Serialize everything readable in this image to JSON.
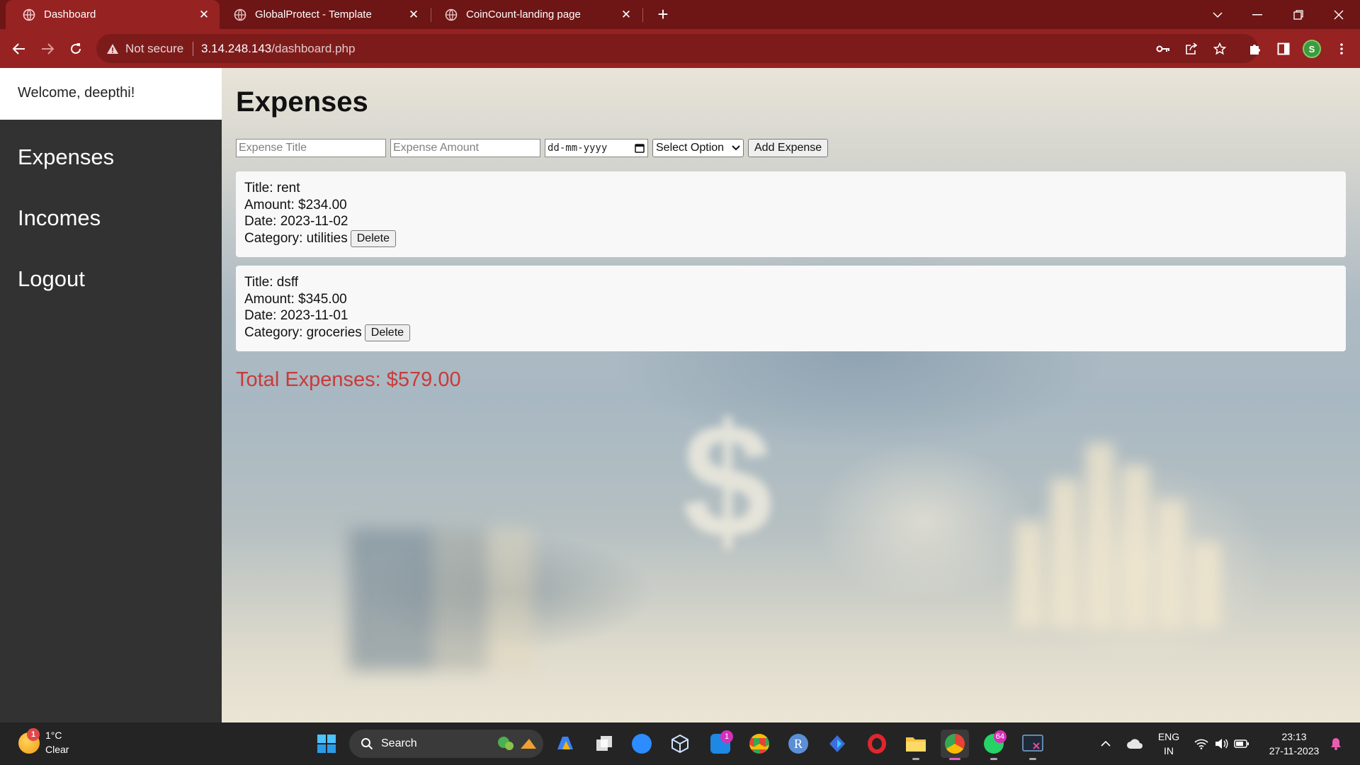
{
  "browser": {
    "tabs": [
      {
        "title": "Dashboard",
        "active": true
      },
      {
        "title": "GlobalProtect - Template",
        "active": false
      },
      {
        "title": "CoinCount-landing page",
        "active": false
      }
    ],
    "tab_close_glyph": "✕",
    "new_tab_glyph": "+",
    "address": {
      "security_label": "Not secure",
      "host": "3.14.248.143",
      "path": "/dashboard.php"
    },
    "profile_initial": "S"
  },
  "sidebar": {
    "welcome": "Welcome, deepthi!",
    "links": [
      {
        "label": "Expenses"
      },
      {
        "label": "Incomes"
      },
      {
        "label": "Logout"
      }
    ]
  },
  "main": {
    "title": "Expenses",
    "form": {
      "title_placeholder": "Expense Title",
      "amount_placeholder": "Expense Amount",
      "date_placeholder": "dd-mm-yyyy",
      "category_selected": "Select Option",
      "submit_label": "Add Expense"
    },
    "expenses": [
      {
        "title": "Title: rent",
        "amount": "Amount: $234.00",
        "date": "Date: 2023-11-02",
        "category": "Category: utilities",
        "delete_label": "Delete"
      },
      {
        "title": "Title: dsff",
        "amount": "Amount: $345.00",
        "date": "Date: 2023-11-01",
        "category": "Category: groceries",
        "delete_label": "Delete"
      }
    ],
    "total": "Total Expenses: $579.00",
    "background_glyph": "$"
  },
  "taskbar": {
    "weather": {
      "temp": "1°C",
      "desc": "Clear",
      "badge": "1"
    },
    "search_label": "Search",
    "apps": [
      {
        "icon": "zoom-icon",
        "color": "#2d8cff"
      },
      {
        "icon": "mail-icon",
        "color": "#1e88e5",
        "badge": "1"
      },
      {
        "icon": "chrome-icon",
        "color": "#e94235"
      },
      {
        "icon": "r-icon",
        "color": "#5b8fd6",
        "glyph": "R"
      },
      {
        "icon": "opera-icon",
        "color": "#e0262e"
      },
      {
        "icon": "whatsapp-icon",
        "color": "#25d366",
        "badge": "64"
      }
    ],
    "tray": {
      "lang_top": "ENG",
      "lang_bottom": "IN",
      "time": "23:13",
      "date": "27-11-2023"
    },
    "colors": {
      "accent": "#962222",
      "tab_strip": "#6e1515",
      "total_red": "#c93a3a"
    }
  }
}
